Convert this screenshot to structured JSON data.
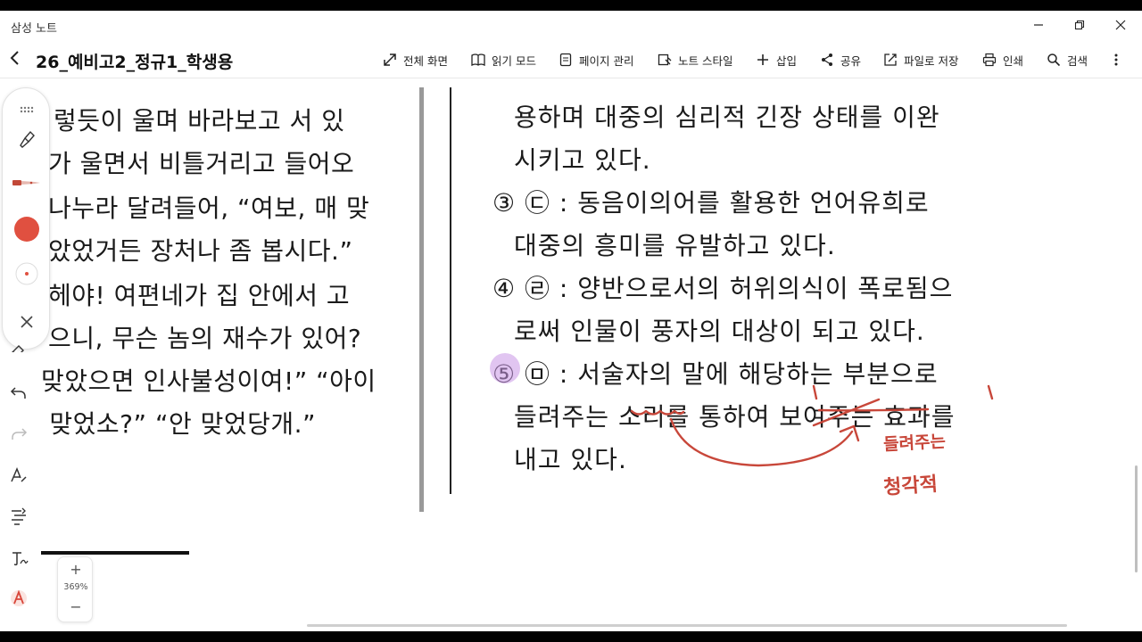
{
  "window": {
    "app_title": "삼성 노트",
    "controls": [
      "minimize",
      "maximize",
      "close"
    ]
  },
  "toolbar": {
    "back_icon": "chevron-left-icon",
    "doc_title": "26_예비고2_정규1_학생용",
    "items": [
      {
        "label": "전체 화면",
        "icon": "expand-icon"
      },
      {
        "label": "읽기 모드",
        "icon": "book-icon"
      },
      {
        "label": "페이지 관리",
        "icon": "page-icon"
      },
      {
        "label": "노트 스타일",
        "icon": "style-icon"
      },
      {
        "label": "삽입",
        "icon": "plus-icon"
      },
      {
        "label": "공유",
        "icon": "share-icon"
      },
      {
        "label": "파일로 저장",
        "icon": "export-icon"
      },
      {
        "label": "인쇄",
        "icon": "print-icon"
      },
      {
        "label": "검색",
        "icon": "search-icon"
      }
    ],
    "more_icon": "more-vertical-icon"
  },
  "left_page": {
    "lines": [
      "렇듯이 울며 바라보고 서 있",
      "가 울면서 비틀거리고 들어오",
      "나누라 달려들어, “여보, 매 맞",
      "았었거든 장처나 좀 봅시다.”",
      "헤야! 여편네가 집 안에서 고",
      "으니, 무슨 놈의 재수가 있어?",
      "맞았으면 인사불성이여!” “아이",
      " 맞었소?” “안 맞었당개.”"
    ]
  },
  "right_page": {
    "lines": [
      "용하며 대중의 심리적 긴장 상태를 이완",
      "시키고 있다.",
      "③ ㉢ : 동음이의어를 활용한 언어유희로",
      "대중의 흥미를 유발하고 있다.",
      "④ ㉣ : 양반으로서의 허위의식이 폭로됨으",
      "로써 인물이 풍자의 대상이 되고 있다.",
      "⑤ ㉤ : 서술자의 말에 해당하는 부분으로",
      "들려주는 소리를 통하여 보여주는 효과를",
      "내고 있다."
    ]
  },
  "handwriting": {
    "note1": "들려주는",
    "note2": "청각적",
    "color": "#c8473a"
  },
  "pen_palette": {
    "tools": [
      "grid-handle-icon",
      "highlighter-icon",
      "pen-icon",
      "color-swatch",
      "size-dot-icon",
      "close-icon"
    ],
    "color": "#e05040"
  },
  "side_tools": [
    "eraser-icon",
    "undo-icon",
    "redo-icon",
    "text-tool-icon",
    "align-icon",
    "handwriting-icon",
    "pen-a-icon"
  ],
  "zoom": {
    "plus": "+",
    "level": "369%",
    "minus": "−"
  }
}
